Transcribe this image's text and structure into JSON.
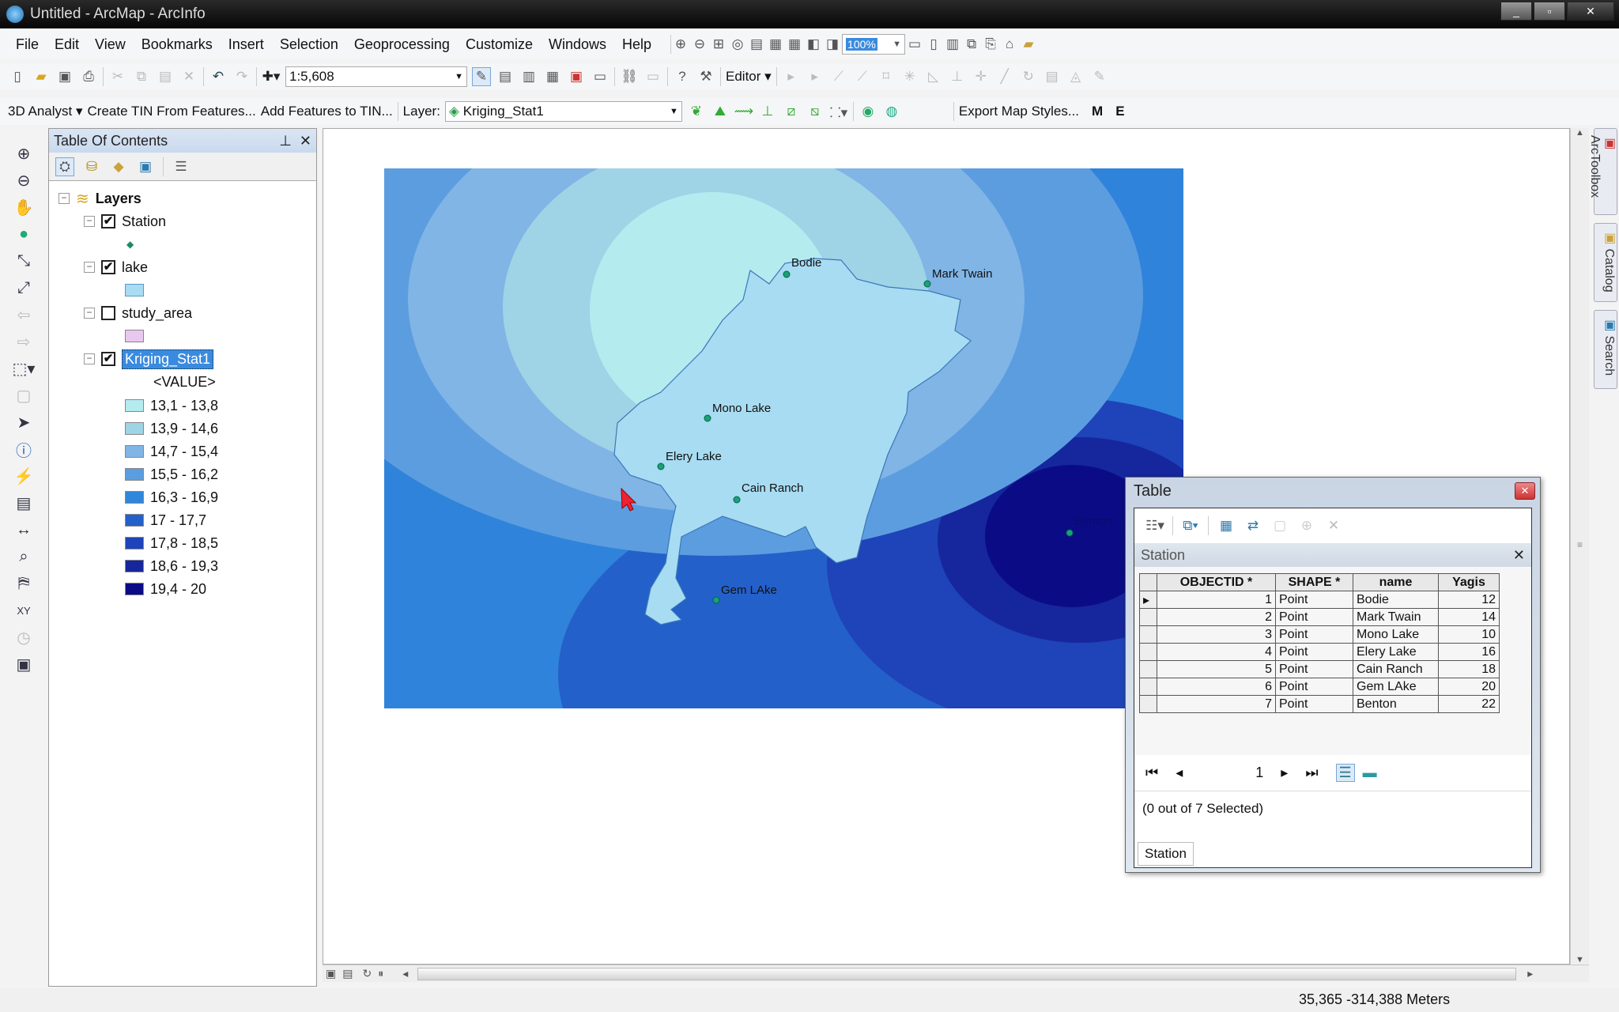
{
  "window": {
    "title": "Untitled - ArcMap - ArcInfo"
  },
  "menu": [
    "File",
    "Edit",
    "View",
    "Bookmarks",
    "Insert",
    "Selection",
    "Geoprocessing",
    "Customize",
    "Windows",
    "Help"
  ],
  "toolbar": {
    "scale": "1:5,608",
    "zoom_percent": "100%",
    "editor": "Editor",
    "analyst": "3D Analyst",
    "create_tin": "Create TIN From Features...",
    "add_features": "Add Features to TIN...",
    "layer_label": "Layer:",
    "layer_value": "Kriging_Stat1",
    "export_styles": "Export Map Styles...",
    "m": "M",
    "e": "E"
  },
  "toc": {
    "title": "Table Of Contents",
    "root": "Layers",
    "layers": [
      {
        "name": "Station",
        "checked": true
      },
      {
        "name": "lake",
        "checked": true
      },
      {
        "name": "study_area",
        "checked": false
      },
      {
        "name": "Kriging_Stat1",
        "checked": true
      }
    ],
    "value_label": "<VALUE>",
    "legend": [
      {
        "label": "13,1 - 13,8",
        "color": "#b4ebef"
      },
      {
        "label": "13,9 - 14,6",
        "color": "#9fd3e6"
      },
      {
        "label": "14,7 - 15,4",
        "color": "#80b5e6"
      },
      {
        "label": "15,5 - 16,2",
        "color": "#5c9de0"
      },
      {
        "label": "16,3 - 16,9",
        "color": "#2f86da"
      },
      {
        "label": "17 - 17,7",
        "color": "#2460c9"
      },
      {
        "label": "17,8 - 18,5",
        "color": "#1f43b8"
      },
      {
        "label": "18,6 - 19,3",
        "color": "#16279e"
      },
      {
        "label": "19,4 - 20",
        "color": "#0b0c85"
      }
    ]
  },
  "map": {
    "stations": [
      "Bodie",
      "Mark Twain",
      "Mono Lake",
      "Elery Lake",
      "Cain Ranch",
      "Gem LAke",
      "Benton"
    ]
  },
  "table": {
    "title": "Table",
    "layer": "Station",
    "columns": [
      "OBJECTID *",
      "SHAPE *",
      "name",
      "Yagis"
    ],
    "rows": [
      [
        "1",
        "Point",
        "Bodie",
        "12"
      ],
      [
        "2",
        "Point",
        "Mark Twain",
        "14"
      ],
      [
        "3",
        "Point",
        "Mono Lake",
        "10"
      ],
      [
        "4",
        "Point",
        "Elery Lake",
        "16"
      ],
      [
        "5",
        "Point",
        "Cain Ranch",
        "18"
      ],
      [
        "6",
        "Point",
        "Gem LAke",
        "20"
      ],
      [
        "7",
        "Point",
        "Benton",
        "22"
      ]
    ],
    "page": "1",
    "selection": "(0 out of 7 Selected)",
    "tab": "Station"
  },
  "dock": [
    "ArcToolbox",
    "Catalog",
    "Search"
  ],
  "status": {
    "coords": "35,365  -314,388 Meters"
  }
}
